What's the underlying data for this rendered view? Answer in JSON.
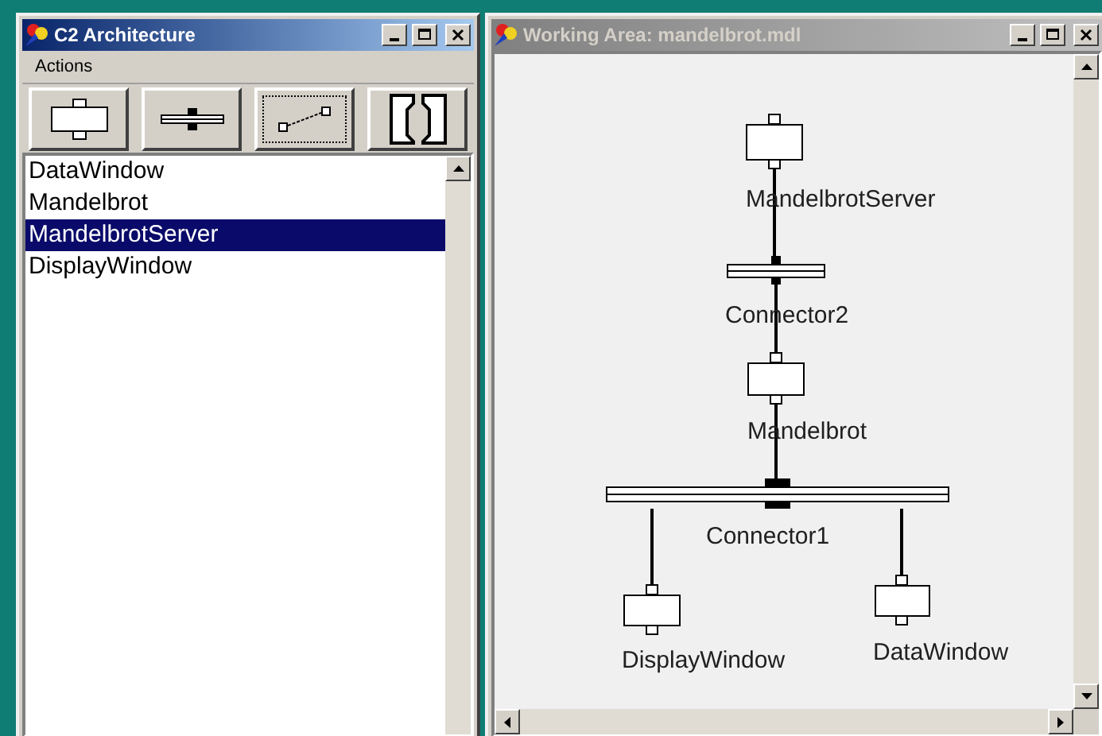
{
  "architecture_window": {
    "title": "C2 Architecture",
    "active": true,
    "menu": [
      "Actions"
    ],
    "toolbar": [
      {
        "kind": "component",
        "focused": false
      },
      {
        "kind": "connector",
        "focused": false
      },
      {
        "kind": "link",
        "focused": true
      },
      {
        "kind": "split",
        "focused": false
      }
    ],
    "list_items": [
      {
        "label": "DataWindow",
        "selected": false
      },
      {
        "label": "Mandelbrot",
        "selected": false
      },
      {
        "label": "MandelbrotServer",
        "selected": true
      },
      {
        "label": "DisplayWindow",
        "selected": false
      }
    ]
  },
  "working_area": {
    "title": "Working Area: mandelbrot.mdl",
    "active": false,
    "nodes": [
      {
        "kind": "component",
        "label": "MandelbrotServer"
      },
      {
        "kind": "connector",
        "label": "Connector2"
      },
      {
        "kind": "component",
        "label": "Mandelbrot"
      },
      {
        "kind": "connector",
        "label": "Connector1"
      },
      {
        "kind": "component",
        "label": "DisplayWindow"
      },
      {
        "kind": "component",
        "label": "DataWindow"
      }
    ]
  }
}
